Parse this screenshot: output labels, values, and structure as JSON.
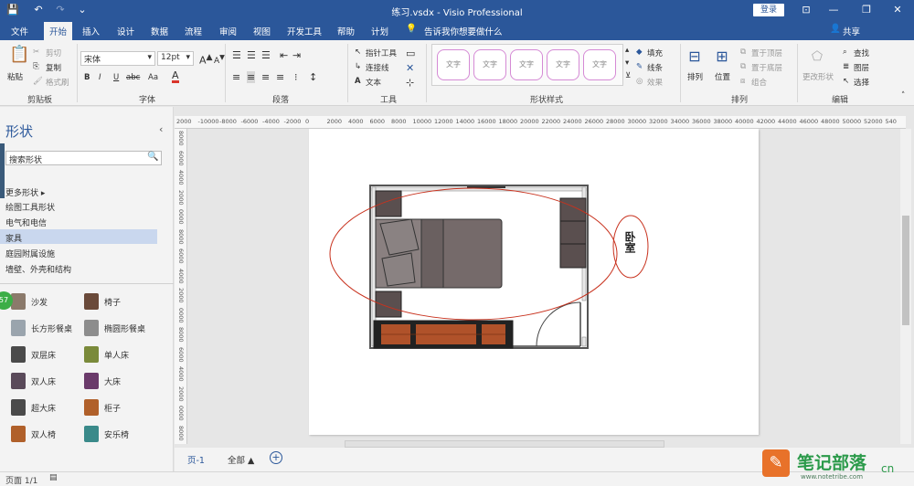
{
  "window": {
    "title": "练习.vsdx - Visio Professional",
    "login_label": "登录",
    "min_glyph": "—",
    "max_glyph": "❐",
    "close_glyph": "✕",
    "ribbon_opts_glyph": "⊡"
  },
  "menu": {
    "items": [
      "文件",
      "开始",
      "插入",
      "设计",
      "数据",
      "流程",
      "审阅",
      "视图",
      "开发工具",
      "帮助",
      "计划"
    ],
    "active_index": 1,
    "tell_me": "告诉我你想要做什么",
    "share": "共享"
  },
  "ribbon": {
    "clipboard": {
      "paste": "粘贴",
      "cut": "剪切",
      "copy": "复制",
      "format_painter": "格式刷",
      "group": "剪贴板"
    },
    "font": {
      "family": "宋体",
      "size": "12pt",
      "bold": "B",
      "italic": "I",
      "underline": "U",
      "strike": "abc",
      "case": "Aa",
      "group": "字体"
    },
    "paragraph": {
      "group": "段落"
    },
    "tools": {
      "pointer": "指针工具",
      "connector": "连接线",
      "text": "文本",
      "group": "工具"
    },
    "shape_styles": {
      "sample": "文字",
      "fill": "填充",
      "line": "线条",
      "effects": "效果",
      "group": "形状样式"
    },
    "arrange": {
      "align": "排列",
      "position": "位置",
      "bring_front": "置于顶层",
      "send_back": "置于底层",
      "group_cmd": "组合",
      "group": "排列"
    },
    "editing": {
      "change_shape": "更改形状",
      "find": "查找",
      "layers": "图层",
      "select": "选择",
      "group": "编辑"
    }
  },
  "shapes_pane": {
    "title": "形状",
    "search_placeholder": "搜索形状",
    "stencils": [
      "更多形状",
      "绘图工具形状",
      "电气和电信",
      "家具",
      "庭园附属设施",
      "墙壁、外壳和结构"
    ],
    "selected_stencil_index": 3,
    "shapes": [
      {
        "label": "沙发",
        "color": "#8b7a6b"
      },
      {
        "label": "椅子",
        "color": "#6a4a3a"
      },
      {
        "label": "长方形餐桌",
        "color": "#9aa4ad"
      },
      {
        "label": "椭圆形餐桌",
        "color": "#8d8d8d"
      },
      {
        "label": "双层床",
        "color": "#4a4a4a"
      },
      {
        "label": "单人床",
        "color": "#7a8a3a"
      },
      {
        "label": "双人床",
        "color": "#5a4a5a"
      },
      {
        "label": "大床",
        "color": "#6a3a6a"
      },
      {
        "label": "超大床",
        "color": "#4a4a4a"
      },
      {
        "label": "柜子",
        "color": "#b0602a"
      },
      {
        "label": "双人椅",
        "color": "#b0602a"
      },
      {
        "label": "安乐椅",
        "color": "#3a8a8a"
      }
    ],
    "badge": "57"
  },
  "ruler": {
    "top": [
      "2000",
      "-10000",
      "-8000",
      "-6000",
      "-4000",
      "-2000",
      "0",
      "2000",
      "4000",
      "6000",
      "8000",
      "10000",
      "12000",
      "14000",
      "16000",
      "18000",
      "20000",
      "22000",
      "24000",
      "26000",
      "28000",
      "30000",
      "32000",
      "34000",
      "36000",
      "38000",
      "40000",
      "42000",
      "44000",
      "46000",
      "48000",
      "50000",
      "52000",
      "540"
    ],
    "left": [
      "8000",
      "6000",
      "4000",
      "2000",
      "0000",
      "8000",
      "6000",
      "4000",
      "2000",
      "0000",
      "8000",
      "6000",
      "4000",
      "2000",
      "0000",
      "8000"
    ]
  },
  "drawing": {
    "room_label": "卧室"
  },
  "tabs": {
    "page": "页-1",
    "all": "全部",
    "all_caret": "▲",
    "add": "+"
  },
  "status": {
    "page_info": "页面 1/1"
  },
  "watermark": {
    "text": "笔记部落",
    "site": "www.notetribe.com",
    "suffix": "cn"
  }
}
